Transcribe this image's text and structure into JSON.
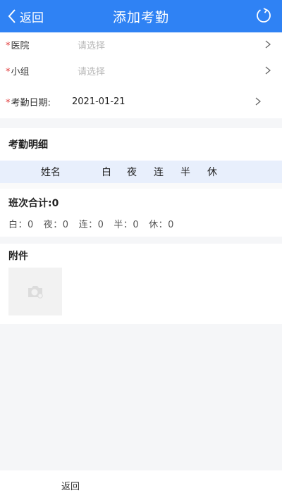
{
  "header": {
    "back_label": "返回",
    "title": "添加考勤"
  },
  "form": {
    "hospital": {
      "required_mark": "*",
      "label": "医院",
      "placeholder": "请选择"
    },
    "group": {
      "required_mark": "*",
      "label": "小组",
      "placeholder": "请选择"
    },
    "date": {
      "required_mark": "*",
      "label": "考勤日期:",
      "value": "2021-01-21"
    }
  },
  "detail": {
    "title": "考勤明细",
    "columns": [
      "姓名",
      "白",
      "夜",
      "连",
      "半",
      "休"
    ]
  },
  "summary": {
    "title": "班次合计:0",
    "items": [
      "白：0",
      "夜：0",
      "连：0",
      "半：0",
      "休：0"
    ]
  },
  "attachment": {
    "title": "附件"
  },
  "footer": {
    "back_label": "返回"
  },
  "colors": {
    "header_bg": "#2f82f4",
    "required": "#e03a3a",
    "table_head_bg": "#e8effc"
  }
}
